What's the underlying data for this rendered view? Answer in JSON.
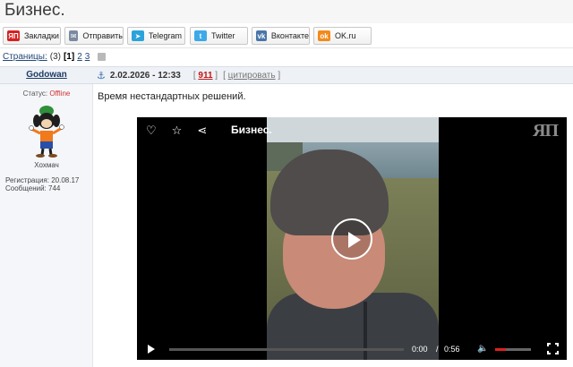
{
  "page": {
    "title": "Бизнес."
  },
  "share": [
    {
      "label": "Закладки",
      "icon": "yap-icon",
      "icon_text": "ЯП",
      "color": "#d62020"
    },
    {
      "label": "Отправить",
      "icon": "mail-icon",
      "icon_text": "✉",
      "color": "#7a8aa0"
    },
    {
      "label": "Telegram",
      "icon": "telegram-icon",
      "icon_text": "➤",
      "color": "#2aa3dc"
    },
    {
      "label": "Twitter",
      "icon": "twitter-icon",
      "icon_text": "t",
      "color": "#3ca9e8"
    },
    {
      "label": "Вконтакте",
      "icon": "vk-icon",
      "icon_text": "vk",
      "color": "#4a76a8"
    },
    {
      "label": "OK.ru",
      "icon": "ok-icon",
      "icon_text": "ok",
      "color": "#f28a1b"
    }
  ],
  "pagination": {
    "label": "Страницы:",
    "count": "(3)",
    "pages": [
      "[1]",
      "2",
      "3"
    ]
  },
  "post": {
    "author": "Godowan",
    "date": "2.02.2026 - 12:33",
    "rating": "911",
    "quote_label": "цитировать",
    "text": "Время нестандартных решений."
  },
  "profile": {
    "status_label": "Статус:",
    "status_value": "Offline",
    "nickname": "Хохмач",
    "registration": "Регистрация: 20.08.17",
    "messages": "Сообщений: 744"
  },
  "video": {
    "title": "Бизнес.",
    "logo": "ЯП",
    "current_time": "0:00",
    "separator": "/",
    "duration": "0:56",
    "progress": 0,
    "volume": 0.3
  }
}
